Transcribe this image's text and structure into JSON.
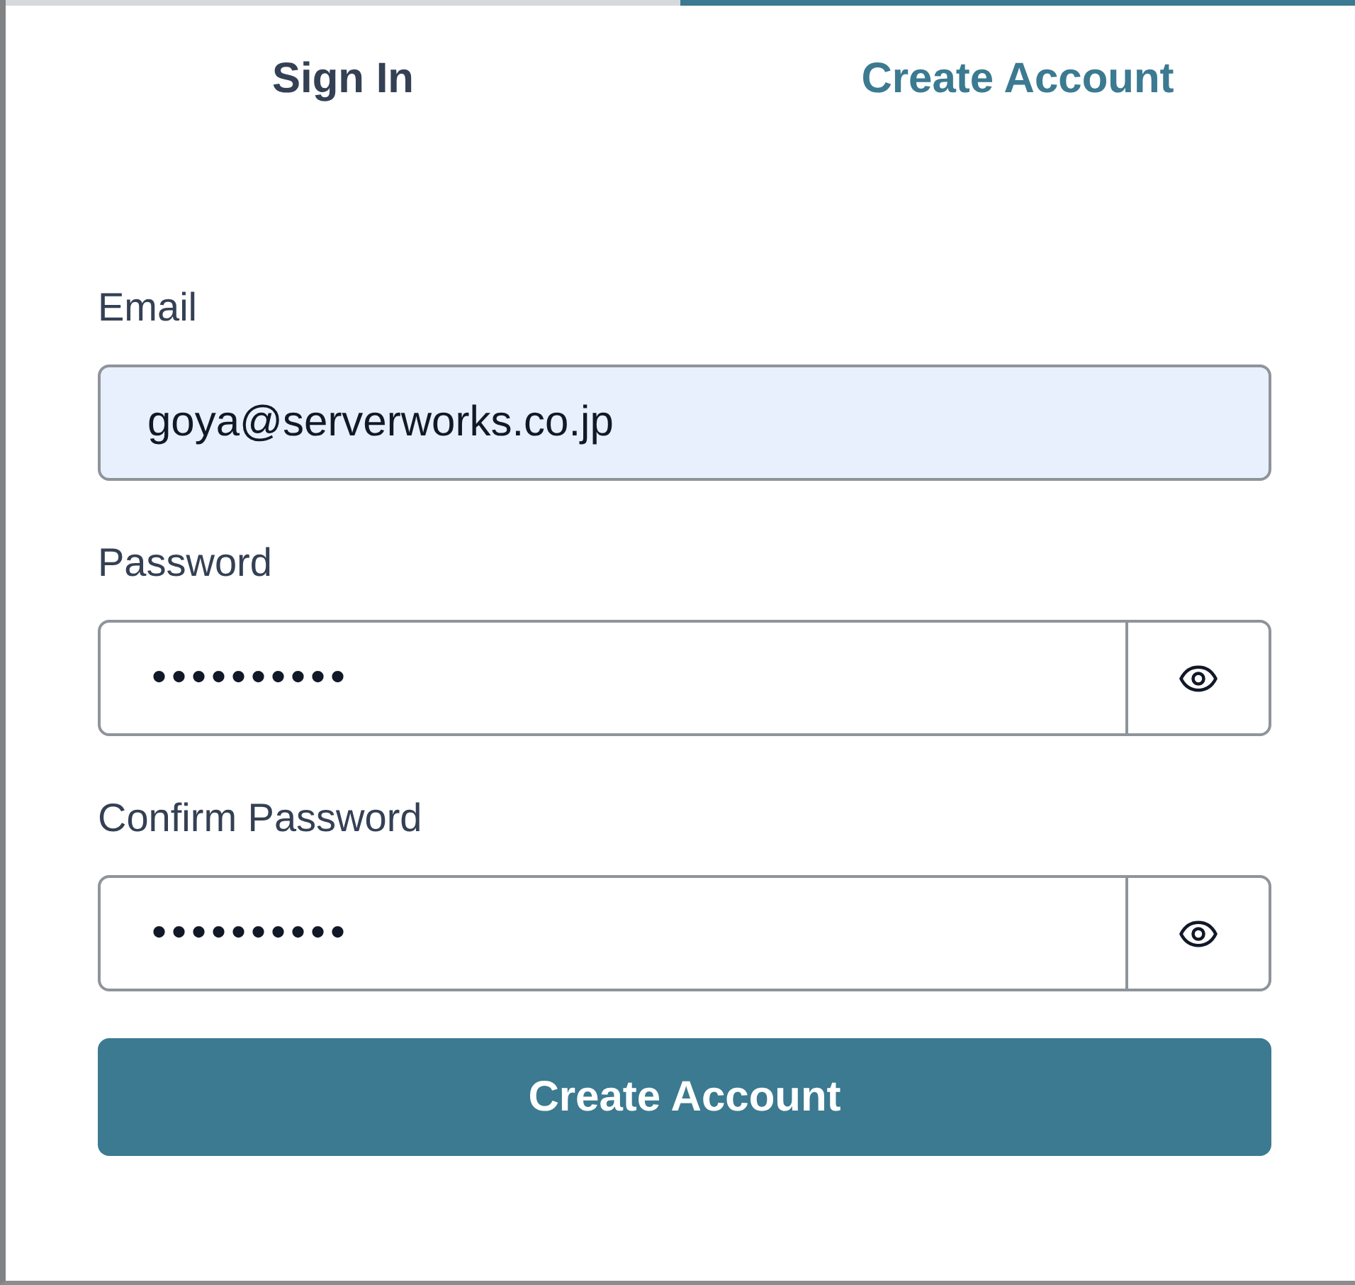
{
  "tabs": [
    {
      "label": "Sign In",
      "selected": false
    },
    {
      "label": "Create Account",
      "selected": true
    }
  ],
  "fields": [
    {
      "kind": "text",
      "label": "Email",
      "value": "goya@serverworks.co.jp",
      "autofilled": true
    },
    {
      "kind": "password",
      "label": "Password",
      "value": "••••••••••",
      "autofilled": false
    },
    {
      "kind": "password",
      "label": "Confirm Password",
      "value": "••••••••••",
      "autofilled": false
    }
  ],
  "submit_button": {
    "label": "Create Account"
  }
}
